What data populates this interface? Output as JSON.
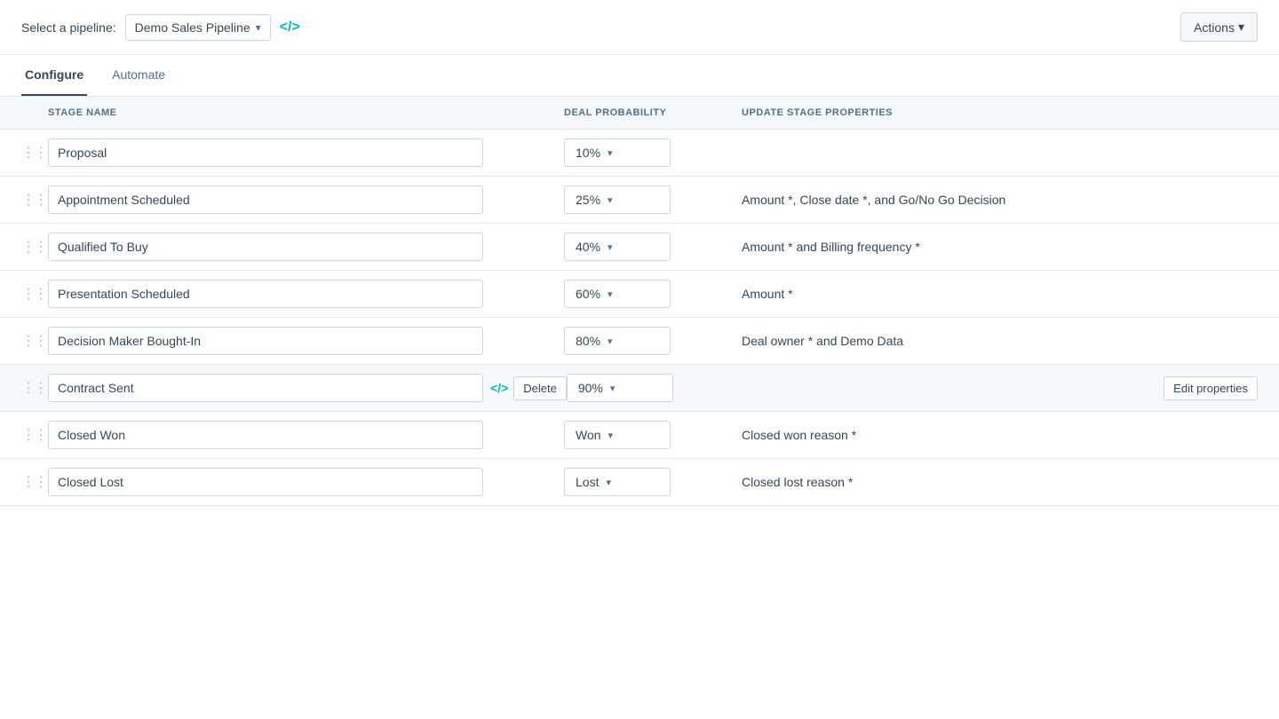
{
  "header": {
    "pipeline_label": "Select a pipeline:",
    "pipeline_name": "Demo Sales Pipeline",
    "actions_label": "Actions"
  },
  "tabs": [
    {
      "id": "configure",
      "label": "Configure",
      "active": true
    },
    {
      "id": "automate",
      "label": "Automate",
      "active": false
    }
  ],
  "table": {
    "columns": [
      {
        "id": "drag",
        "label": ""
      },
      {
        "id": "stage_name",
        "label": "STAGE NAME"
      },
      {
        "id": "deal_probability",
        "label": "DEAL PROBABILITY"
      },
      {
        "id": "update_stage_properties",
        "label": "UPDATE STAGE PROPERTIES"
      }
    ],
    "rows": [
      {
        "id": "proposal",
        "stage_name": "Proposal",
        "probability": "10%",
        "properties": "",
        "show_edit": false,
        "show_code": false,
        "show_delete": false,
        "active": false
      },
      {
        "id": "appointment-scheduled",
        "stage_name": "Appointment Scheduled",
        "probability": "25%",
        "properties": "Amount *, Close date *, and Go/No Go Decision",
        "show_edit": false,
        "show_code": false,
        "show_delete": false,
        "active": false
      },
      {
        "id": "qualified-to-buy",
        "stage_name": "Qualified To Buy",
        "probability": "40%",
        "properties": "Amount * and Billing frequency *",
        "show_edit": false,
        "show_code": false,
        "show_delete": false,
        "active": false
      },
      {
        "id": "presentation-scheduled",
        "stage_name": "Presentation Scheduled",
        "probability": "60%",
        "properties": "Amount *",
        "show_edit": false,
        "show_code": false,
        "show_delete": false,
        "active": false
      },
      {
        "id": "decision-maker",
        "stage_name": "Decision Maker Bought-In",
        "probability": "80%",
        "properties": "Deal owner * and Demo Data",
        "show_edit": false,
        "show_code": false,
        "show_delete": false,
        "active": false
      },
      {
        "id": "contract-sent",
        "stage_name": "Contract Sent",
        "probability": "90%",
        "properties": "",
        "show_edit": true,
        "show_code": true,
        "show_delete": true,
        "active": true
      },
      {
        "id": "closed-won",
        "stage_name": "Closed Won",
        "probability": "Won",
        "properties": "Closed won reason *",
        "show_edit": false,
        "show_code": false,
        "show_delete": false,
        "active": false
      },
      {
        "id": "closed-lost",
        "stage_name": "Closed Lost",
        "probability": "Lost",
        "properties": "Closed lost reason *",
        "show_edit": false,
        "show_code": false,
        "show_delete": false,
        "active": false
      }
    ]
  },
  "labels": {
    "edit_properties": "Edit properties",
    "delete": "Delete",
    "code_icon": "</>",
    "drag_icon": "⠿",
    "chevron_down": "▾"
  }
}
